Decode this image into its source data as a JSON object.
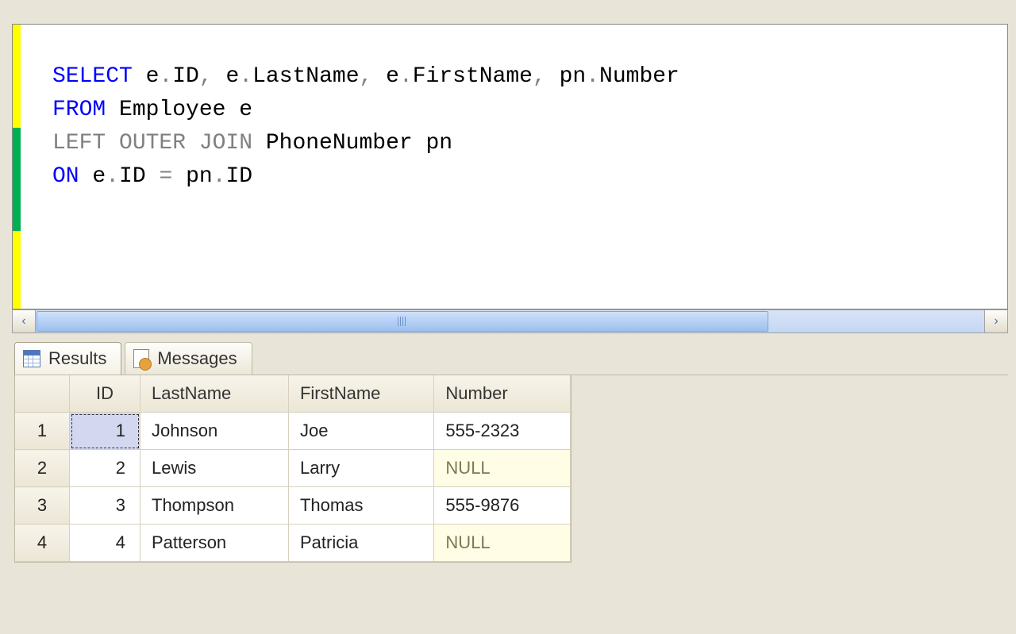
{
  "sql": {
    "tokens": [
      {
        "t": "SELECT",
        "c": "kw-blue"
      },
      {
        "t": " e"
      },
      {
        "t": ".",
        "c": "op"
      },
      {
        "t": "ID"
      },
      {
        "t": ",",
        "c": "op"
      },
      {
        "t": " e"
      },
      {
        "t": ".",
        "c": "op"
      },
      {
        "t": "LastName"
      },
      {
        "t": ",",
        "c": "op"
      },
      {
        "t": " e"
      },
      {
        "t": ".",
        "c": "op"
      },
      {
        "t": "FirstName"
      },
      {
        "t": ",",
        "c": "op"
      },
      {
        "t": " pn"
      },
      {
        "t": ".",
        "c": "op"
      },
      {
        "t": "Number"
      },
      {
        "t": "\n"
      },
      {
        "t": "FROM",
        "c": "kw-blue"
      },
      {
        "t": " Employee e"
      },
      {
        "t": "\n"
      },
      {
        "t": "LEFT OUTER JOIN",
        "c": "kw-gray"
      },
      {
        "t": " PhoneNumber pn"
      },
      {
        "t": "\n"
      },
      {
        "t": "ON",
        "c": "kw-blue"
      },
      {
        "t": " e"
      },
      {
        "t": ".",
        "c": "op"
      },
      {
        "t": "ID "
      },
      {
        "t": "=",
        "c": "op"
      },
      {
        "t": " pn"
      },
      {
        "t": ".",
        "c": "op"
      },
      {
        "t": "ID"
      }
    ]
  },
  "tabs": {
    "results": "Results",
    "messages": "Messages"
  },
  "results": {
    "columns": [
      "ID",
      "LastName",
      "FirstName",
      "Number"
    ],
    "rows": [
      {
        "n": "1",
        "ID": "1",
        "LastName": "Johnson",
        "FirstName": "Joe",
        "Number": "555-2323",
        "null": false,
        "selected": true
      },
      {
        "n": "2",
        "ID": "2",
        "LastName": "Lewis",
        "FirstName": "Larry",
        "Number": "NULL",
        "null": true,
        "selected": false
      },
      {
        "n": "3",
        "ID": "3",
        "LastName": "Thompson",
        "FirstName": "Thomas",
        "Number": "555-9876",
        "null": false,
        "selected": false
      },
      {
        "n": "4",
        "ID": "4",
        "LastName": "Patterson",
        "FirstName": "Patricia",
        "Number": "NULL",
        "null": true,
        "selected": false
      }
    ]
  },
  "scroll": {
    "left_glyph": "‹",
    "right_glyph": "›"
  }
}
